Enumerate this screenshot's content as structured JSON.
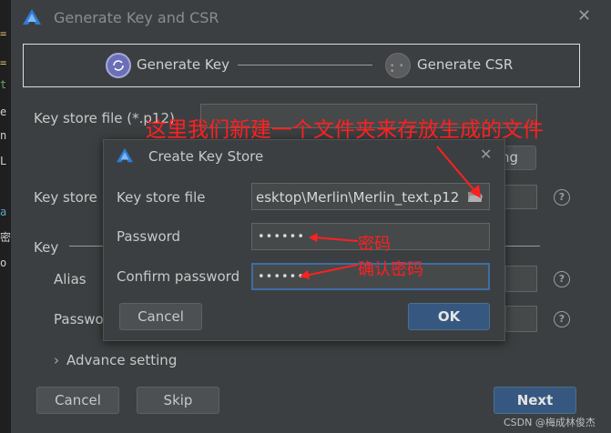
{
  "window": {
    "title": "Generate Key and CSR"
  },
  "steps": [
    {
      "label": "Generate Key",
      "state": "active"
    },
    {
      "label": "Generate CSR",
      "state": "inactive"
    }
  ],
  "form": {
    "key_store_file_label": "Key store file (*.p12)",
    "key_store_password_label": "Key store p",
    "key_section_label": "Key",
    "alias_label": "Alias",
    "password_label": "Passwo",
    "advance_setting_label": "Advance setting",
    "choose_button_partial": "ng"
  },
  "sub_dialog": {
    "title": "Create Key Store",
    "fields": {
      "key_store_file_label": "Key store file",
      "key_store_file_value": "esktop\\Merlin\\Merlin_text.p12",
      "password_label": "Password",
      "password_value": "••••••",
      "confirm_password_label": "Confirm password",
      "confirm_password_value": "••••••"
    },
    "cancel_label": "Cancel",
    "ok_label": "OK"
  },
  "footer": {
    "cancel_label": "Cancel",
    "skip_label": "Skip",
    "next_label": "Next"
  },
  "annotations": {
    "folder_note": "这里我们新建一个文件夹来存放生成的文件",
    "password_note": "密码",
    "confirm_note": "确认密码"
  },
  "watermark": "CSDN @梅成林俊杰",
  "editor_strip_chars": [
    "=",
    "=",
    "t",
    "e",
    "n",
    "L",
    "a",
    "密",
    "o"
  ],
  "colors": {
    "background": "#3c3f41",
    "primary_button": "#365880",
    "annotation": "#ff2020",
    "step_active": "#6b6fb6"
  }
}
